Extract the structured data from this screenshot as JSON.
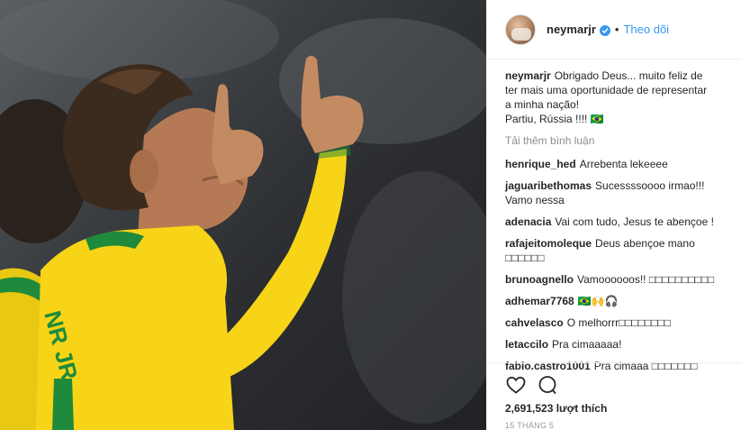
{
  "post": {
    "username": "neymarjr",
    "follow_separator": "•",
    "follow_label": "Theo dõi",
    "caption": {
      "user": "neymarjr",
      "lines": [
        "Obrigado Deus... muito feliz de",
        "ter mais uma oportunidade de representar",
        "a minha nação!",
        "Partiu, Rússia !!!! 🇧🇷"
      ]
    },
    "load_more": "Tải thêm bình luận",
    "comments": [
      {
        "user": "henrique_hed",
        "text": "Arrebenta lekeeee"
      },
      {
        "user": "jaguaribethomas",
        "text": "Sucessssoooo irmao!!! Vamo nessa"
      },
      {
        "user": "adenacia",
        "text": "Vai com tudo, Jesus te abençoe !"
      },
      {
        "user": "rafajeitomoleque",
        "text": "Deus abençoe mano □□□□□□"
      },
      {
        "user": "brunoagnello",
        "text": "Vamoooooos!! □□□□□□□□□□"
      },
      {
        "user": "adhemar7768",
        "text": "🇧🇷🙌🎧"
      },
      {
        "user": "cahvelasco",
        "text": "O melhorrr□□□□□□□□"
      },
      {
        "user": "letaccilo",
        "text": "Pra cimaaaaa!"
      },
      {
        "user": "fabio.castro1001",
        "text": "Pra cimaaa □□□□□□□"
      }
    ],
    "likes": "2,691,523 lượt thích",
    "date": "15 THÁNG 5"
  },
  "colors": {
    "accent": "#3897f0",
    "jersey": "#f7d417",
    "jersey_trim": "#1f8a3b",
    "muted": "#8e8e8e"
  },
  "icons": {
    "like": "heart-icon",
    "comment": "comment-bubble-icon",
    "verified": "verified-badge-icon"
  }
}
